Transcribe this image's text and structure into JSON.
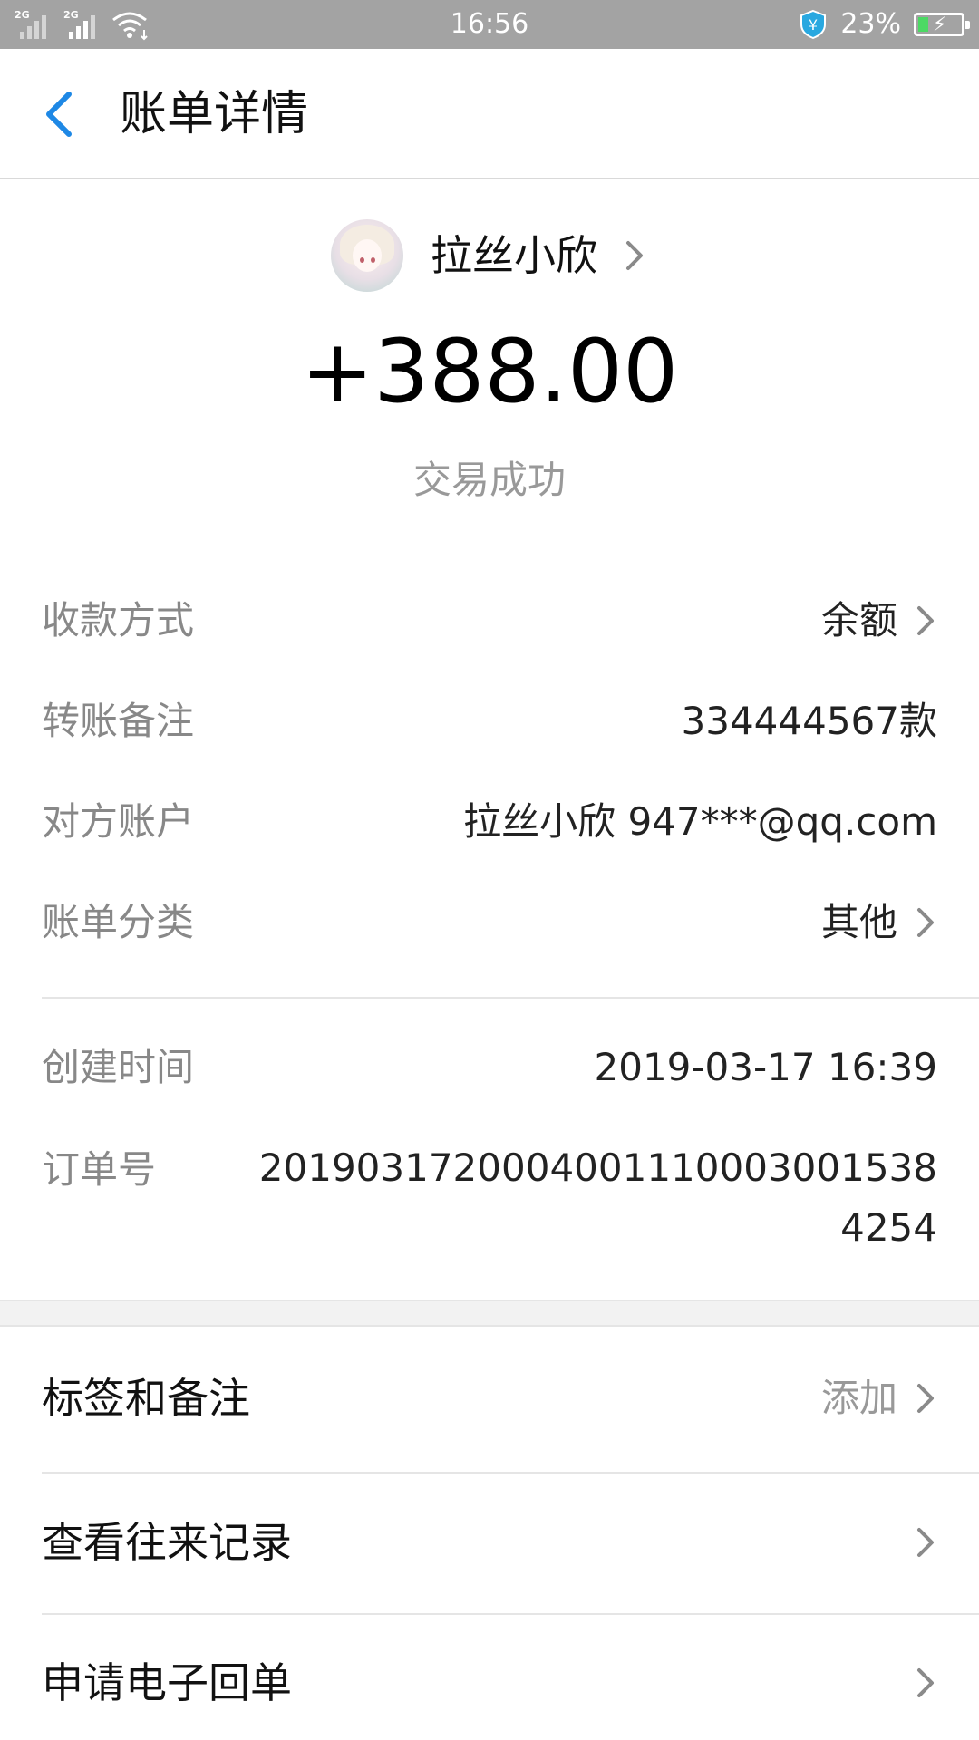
{
  "status_bar": {
    "sim1": "2G",
    "sim2": "2G",
    "time": "16:56",
    "battery_percent": "23%",
    "battery_level": 0.23,
    "accent_green": "#4cd964"
  },
  "nav": {
    "back_icon": "chevron-left-icon",
    "title": "账单详情",
    "accent": "#1e88e5"
  },
  "profile": {
    "name": "拉丝小欣"
  },
  "amount": "+388.00",
  "status": "交易成功",
  "details": [
    {
      "label": "收款方式",
      "value": "余额",
      "chevron": true
    },
    {
      "label": "转账备注",
      "value": "334444567款",
      "chevron": false
    },
    {
      "label": "对方账户",
      "value": "拉丝小欣 947***@qq.com",
      "chevron": false
    },
    {
      "label": "账单分类",
      "value": "其他",
      "chevron": true
    }
  ],
  "meta": {
    "created_label": "创建时间",
    "created_value": "2019-03-17 16:39",
    "order_label": "订单号",
    "order_value": "2019031720004001110003001538425​4"
  },
  "actions": [
    {
      "label": "标签和备注",
      "value": "添加"
    },
    {
      "label": "查看往来记录",
      "value": ""
    },
    {
      "label": "申请电子回单",
      "value": ""
    }
  ]
}
